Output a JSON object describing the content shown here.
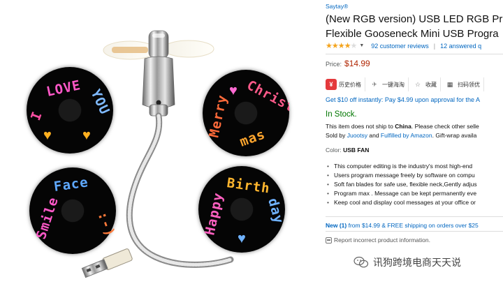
{
  "product_image": {
    "fans": [
      {
        "text": "I LOVE YOU",
        "lines": [
          "I",
          "LOVE",
          "YOU"
        ]
      },
      {
        "text": "Merry Christmas",
        "lines": [
          "Merry",
          "Christ",
          "mas"
        ]
      },
      {
        "text": "Smile Face :-)",
        "lines": [
          "Smile",
          "Face",
          ":-)"
        ]
      },
      {
        "text": "Happy Birthday",
        "lines": [
          "Happy",
          "Birth",
          "day"
        ]
      }
    ]
  },
  "product": {
    "brand": "Saytay®",
    "title_line1": "(New RGB version) USB LED RGB Pr",
    "title_line2": "Flexible Gooseneck Mini USB Progra",
    "stars_label": "★★★★",
    "stars_half": "★",
    "caret": "▼",
    "reviews": "92 customer reviews",
    "separator": "|",
    "answered": "12 answered q",
    "price_label": "Price:",
    "price": "$14.99",
    "promo": "Get $10 off instantly: Pay $4.99 upon approval for the A",
    "stock": "In Stock.",
    "ship_prefix": "This item does not ship to ",
    "ship_country": "China",
    "ship_suffix": ". Please check other selle",
    "sold_by_prefix": "Sold by ",
    "seller": "Juootsy",
    "sold_by_middle": " and ",
    "fulfilled": "Fulfilled by Amazon",
    "sold_by_suffix": ". Gift-wrap availa",
    "color_label": "Color:",
    "color_value": "USB FAN",
    "bullets": [
      "This computer editing is the industry's most high-end",
      "Users program message freely by software on compu",
      "Soft fan blades for safe use, flexible neck,Gently adjus",
      "Program max . Message can be kept permanently eve",
      "Keep cool and display cool messages at your office or"
    ],
    "new_label": "New (1)",
    "new_rest": " from $14.99 & FREE shipping on orders over $25",
    "report": "Report incorrect product information."
  },
  "toolbar": {
    "items": [
      {
        "icon": "price-history-icon",
        "label": "历史价格",
        "color": "#e4393c",
        "glyph": "¥"
      },
      {
        "icon": "airplane-icon",
        "label": "一键海淘",
        "color": "#777777",
        "glyph": "✈"
      },
      {
        "icon": "star-icon",
        "label": "收藏",
        "color": "#777777",
        "glyph": "☆"
      },
      {
        "icon": "qr-code-icon",
        "label": "扫码领优",
        "color": "#444444",
        "glyph": "▦"
      }
    ]
  },
  "watermark": {
    "text": "讯狗跨境电商天天说"
  },
  "colors": {
    "link": "#0066c0",
    "price": "#b12704",
    "stock": "#007600",
    "star": "#f4a41d"
  }
}
